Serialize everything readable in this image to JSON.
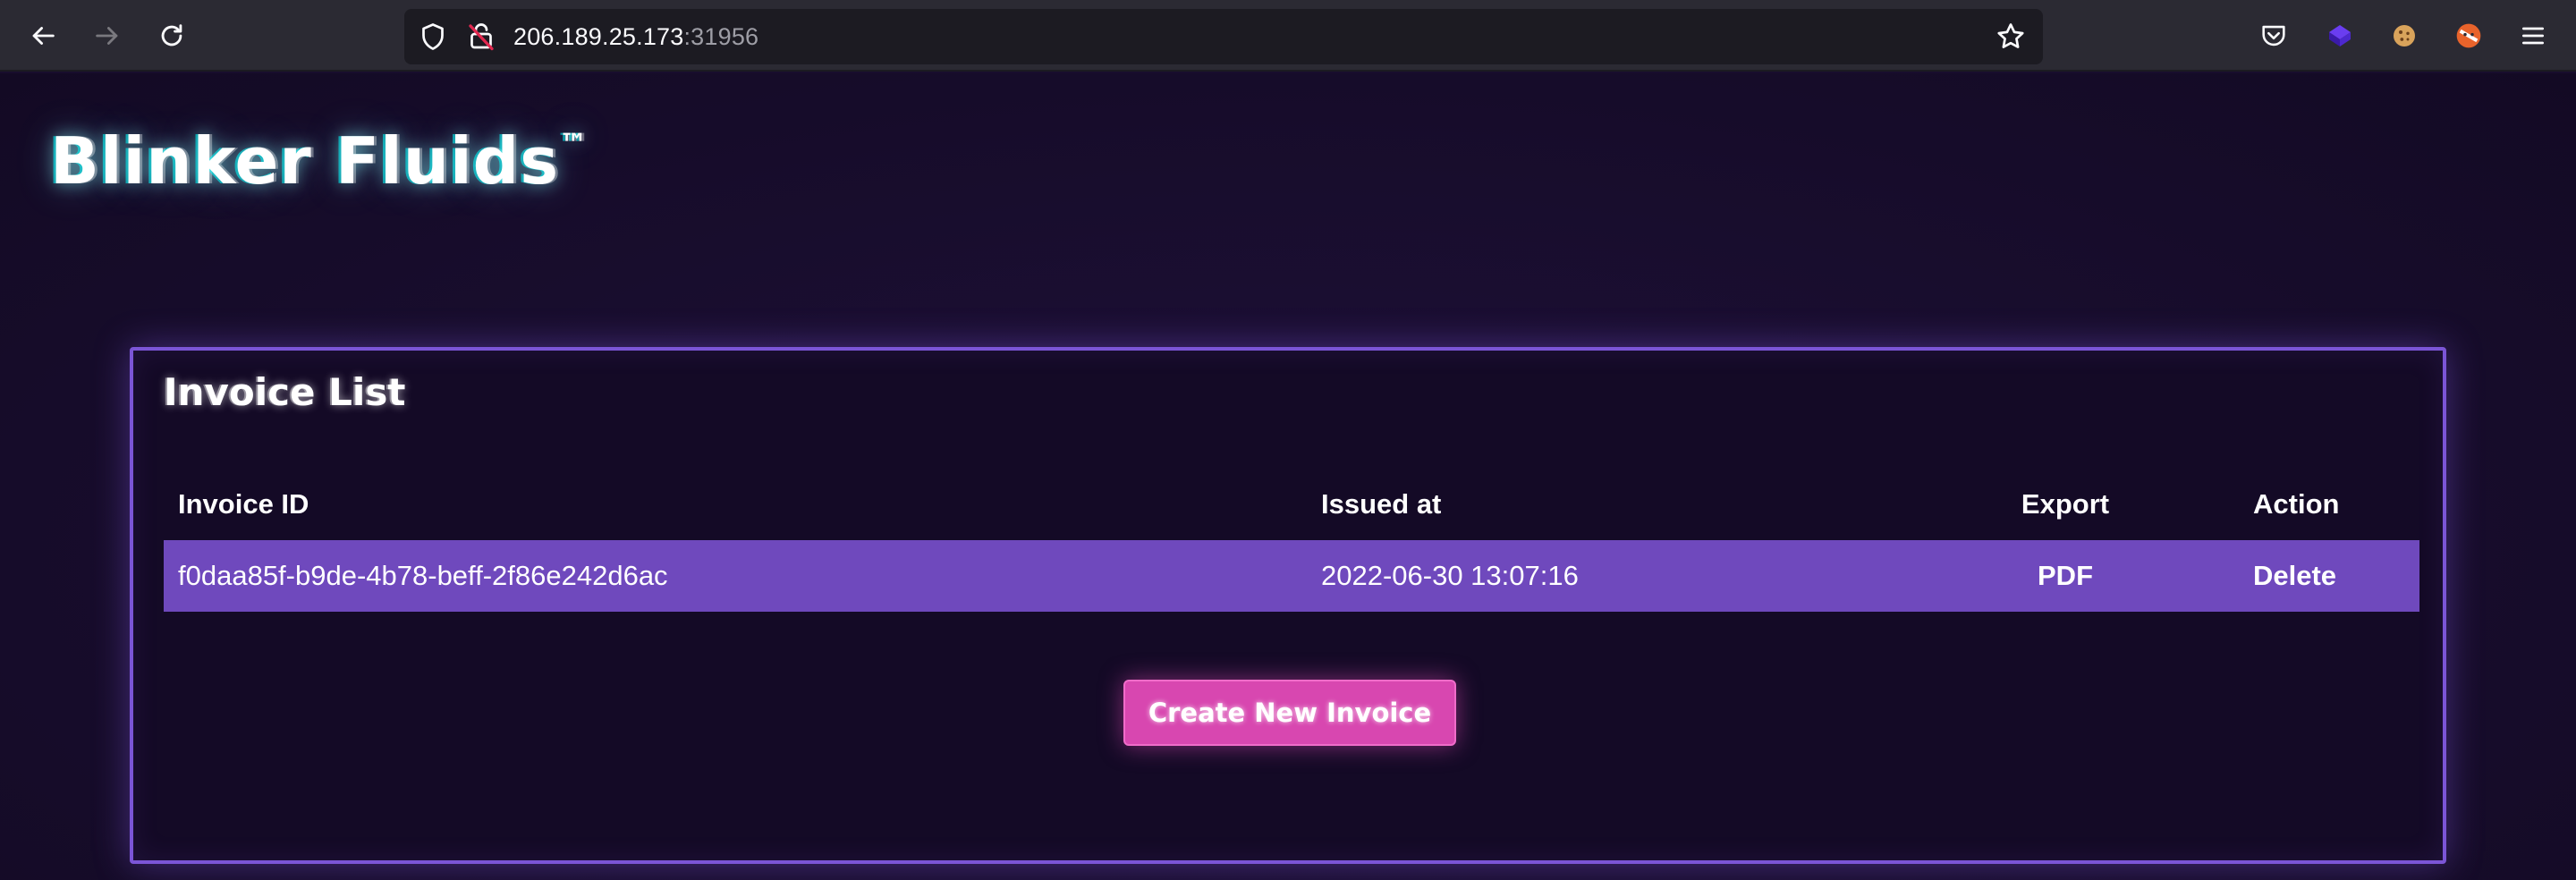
{
  "browser": {
    "url_host": "206.189.25.173",
    "url_port": ":31956",
    "icons": [
      "back-arrow-icon",
      "forward-arrow-icon",
      "reload-icon",
      "shield-icon",
      "insecure-lock-icon",
      "star-icon",
      "pocket-icon",
      "extension-cube-icon",
      "cookie-icon",
      "extension-fox-icon",
      "menu-icon"
    ]
  },
  "app": {
    "logo": "Blinker Fluids",
    "logo_tm": "™"
  },
  "invoice_panel": {
    "title": "Invoice List",
    "columns": {
      "id": "Invoice ID",
      "issued": "Issued at",
      "export": "Export",
      "action": "Action"
    },
    "rows": [
      {
        "id": "f0daa85f-b9de-4b78-beff-2f86e242d6ac",
        "issued": "2022-06-30 13:07:16",
        "export": "PDF",
        "action": "Delete"
      }
    ],
    "create_button": "Create New Invoice"
  },
  "colors": {
    "page_bg": "#180d2d",
    "panel_border": "#7b55d6",
    "row_highlight": "#6f49bd",
    "button_bg": "#d847b0"
  }
}
